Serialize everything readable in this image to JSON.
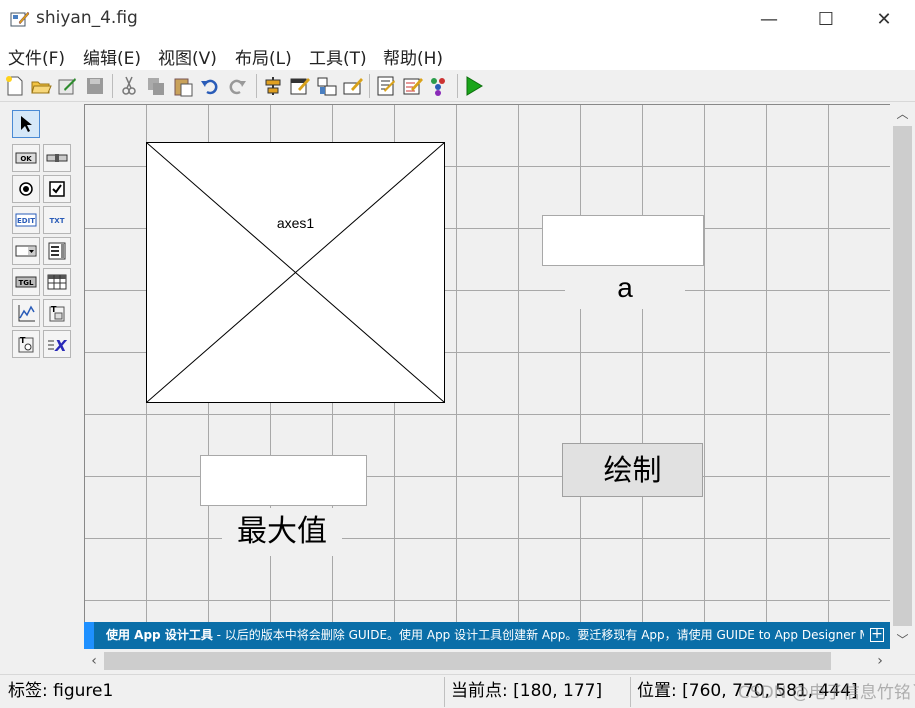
{
  "window": {
    "title": "shiyan_4.fig",
    "minimize_glyph": "—",
    "maximize_glyph": "☐",
    "close_glyph": "✕"
  },
  "menu": {
    "items": [
      "文件(F)",
      "编辑(E)",
      "视图(V)",
      "布局(L)",
      "工具(T)",
      "帮助(H)"
    ]
  },
  "toolbar": {
    "icons": [
      "new-file-icon",
      "open-folder-icon",
      "save-icon",
      "save-disabled-icon",
      "cut-icon",
      "copy-icon",
      "paste-icon",
      "undo-icon",
      "redo-icon",
      "align-icon",
      "menu-editor-icon",
      "tab-order-icon",
      "toolbar-editor-icon",
      "editor-icon",
      "property-inspector-icon",
      "object-browser-icon",
      "run-icon"
    ]
  },
  "palette": {
    "tools": [
      "select-arrow-icon",
      "push-button-icon",
      "slider-icon",
      "radio-button-icon",
      "checkbox-icon",
      "edit-text-icon",
      "static-text-icon",
      "popup-menu-icon",
      "listbox-icon",
      "toggle-button-icon",
      "table-icon",
      "axes-icon",
      "panel-icon",
      "button-group-icon",
      "activex-icon"
    ],
    "labels": {
      "push": "OK",
      "edit": "EDIT",
      "text": "TXT",
      "toggle": "TGL"
    }
  },
  "canvas": {
    "axes_label": "axes1",
    "text_a": "a",
    "text_max": "最大值",
    "button_draw": "绘制"
  },
  "banner": {
    "bold": "使用 App 设计工具",
    "text": " - 以后的版本中将会删除 GUIDE。使用 App 设计工具创建新 App。要迁移现有 App，请使用 GUIDE to App Designer Migr...",
    "expand": "+"
  },
  "status": {
    "tag": "标签: figure1",
    "current_point": "当前点:  [180, 177]",
    "position": "位置: [760, 770, 581, 444]"
  },
  "watermark": "CSDN @电子信息竹铭丫",
  "colors": {
    "banner": "#0a6ea8",
    "banner_accent": "#1e90ff",
    "grid": "#a8a8a8",
    "run": "#1aa51a"
  }
}
